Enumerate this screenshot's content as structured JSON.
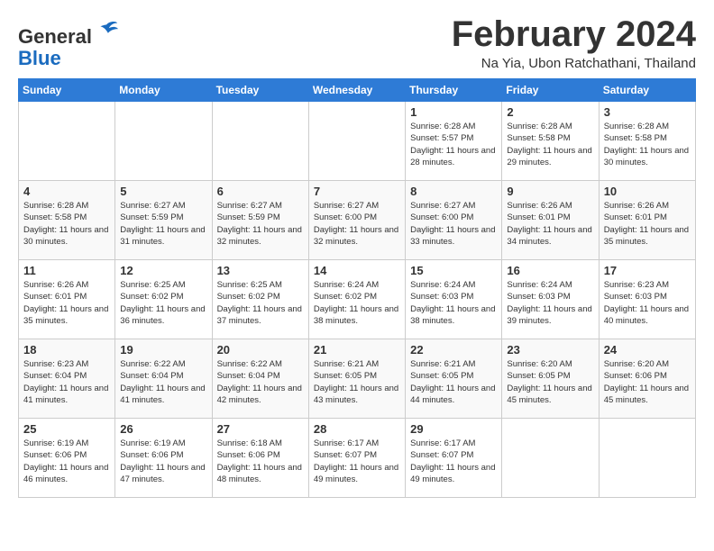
{
  "header": {
    "logo_line1": "General",
    "logo_line2": "Blue",
    "title": "February 2024",
    "subtitle": "Na Yia, Ubon Ratchathani, Thailand"
  },
  "days_of_week": [
    "Sunday",
    "Monday",
    "Tuesday",
    "Wednesday",
    "Thursday",
    "Friday",
    "Saturday"
  ],
  "weeks": [
    [
      {
        "day": "",
        "empty": true
      },
      {
        "day": "",
        "empty": true
      },
      {
        "day": "",
        "empty": true
      },
      {
        "day": "",
        "empty": true
      },
      {
        "day": "1",
        "sunrise": "6:28 AM",
        "sunset": "5:57 PM",
        "daylight": "11 hours and 28 minutes."
      },
      {
        "day": "2",
        "sunrise": "6:28 AM",
        "sunset": "5:58 PM",
        "daylight": "11 hours and 29 minutes."
      },
      {
        "day": "3",
        "sunrise": "6:28 AM",
        "sunset": "5:58 PM",
        "daylight": "11 hours and 30 minutes."
      }
    ],
    [
      {
        "day": "4",
        "sunrise": "6:28 AM",
        "sunset": "5:58 PM",
        "daylight": "11 hours and 30 minutes."
      },
      {
        "day": "5",
        "sunrise": "6:27 AM",
        "sunset": "5:59 PM",
        "daylight": "11 hours and 31 minutes."
      },
      {
        "day": "6",
        "sunrise": "6:27 AM",
        "sunset": "5:59 PM",
        "daylight": "11 hours and 32 minutes."
      },
      {
        "day": "7",
        "sunrise": "6:27 AM",
        "sunset": "6:00 PM",
        "daylight": "11 hours and 32 minutes."
      },
      {
        "day": "8",
        "sunrise": "6:27 AM",
        "sunset": "6:00 PM",
        "daylight": "11 hours and 33 minutes."
      },
      {
        "day": "9",
        "sunrise": "6:26 AM",
        "sunset": "6:01 PM",
        "daylight": "11 hours and 34 minutes."
      },
      {
        "day": "10",
        "sunrise": "6:26 AM",
        "sunset": "6:01 PM",
        "daylight": "11 hours and 35 minutes."
      }
    ],
    [
      {
        "day": "11",
        "sunrise": "6:26 AM",
        "sunset": "6:01 PM",
        "daylight": "11 hours and 35 minutes."
      },
      {
        "day": "12",
        "sunrise": "6:25 AM",
        "sunset": "6:02 PM",
        "daylight": "11 hours and 36 minutes."
      },
      {
        "day": "13",
        "sunrise": "6:25 AM",
        "sunset": "6:02 PM",
        "daylight": "11 hours and 37 minutes."
      },
      {
        "day": "14",
        "sunrise": "6:24 AM",
        "sunset": "6:02 PM",
        "daylight": "11 hours and 38 minutes."
      },
      {
        "day": "15",
        "sunrise": "6:24 AM",
        "sunset": "6:03 PM",
        "daylight": "11 hours and 38 minutes."
      },
      {
        "day": "16",
        "sunrise": "6:24 AM",
        "sunset": "6:03 PM",
        "daylight": "11 hours and 39 minutes."
      },
      {
        "day": "17",
        "sunrise": "6:23 AM",
        "sunset": "6:03 PM",
        "daylight": "11 hours and 40 minutes."
      }
    ],
    [
      {
        "day": "18",
        "sunrise": "6:23 AM",
        "sunset": "6:04 PM",
        "daylight": "11 hours and 41 minutes."
      },
      {
        "day": "19",
        "sunrise": "6:22 AM",
        "sunset": "6:04 PM",
        "daylight": "11 hours and 41 minutes."
      },
      {
        "day": "20",
        "sunrise": "6:22 AM",
        "sunset": "6:04 PM",
        "daylight": "11 hours and 42 minutes."
      },
      {
        "day": "21",
        "sunrise": "6:21 AM",
        "sunset": "6:05 PM",
        "daylight": "11 hours and 43 minutes."
      },
      {
        "day": "22",
        "sunrise": "6:21 AM",
        "sunset": "6:05 PM",
        "daylight": "11 hours and 44 minutes."
      },
      {
        "day": "23",
        "sunrise": "6:20 AM",
        "sunset": "6:05 PM",
        "daylight": "11 hours and 45 minutes."
      },
      {
        "day": "24",
        "sunrise": "6:20 AM",
        "sunset": "6:06 PM",
        "daylight": "11 hours and 45 minutes."
      }
    ],
    [
      {
        "day": "25",
        "sunrise": "6:19 AM",
        "sunset": "6:06 PM",
        "daylight": "11 hours and 46 minutes."
      },
      {
        "day": "26",
        "sunrise": "6:19 AM",
        "sunset": "6:06 PM",
        "daylight": "11 hours and 47 minutes."
      },
      {
        "day": "27",
        "sunrise": "6:18 AM",
        "sunset": "6:06 PM",
        "daylight": "11 hours and 48 minutes."
      },
      {
        "day": "28",
        "sunrise": "6:17 AM",
        "sunset": "6:07 PM",
        "daylight": "11 hours and 49 minutes."
      },
      {
        "day": "29",
        "sunrise": "6:17 AM",
        "sunset": "6:07 PM",
        "daylight": "11 hours and 49 minutes."
      },
      {
        "day": "",
        "empty": true
      },
      {
        "day": "",
        "empty": true
      }
    ]
  ]
}
